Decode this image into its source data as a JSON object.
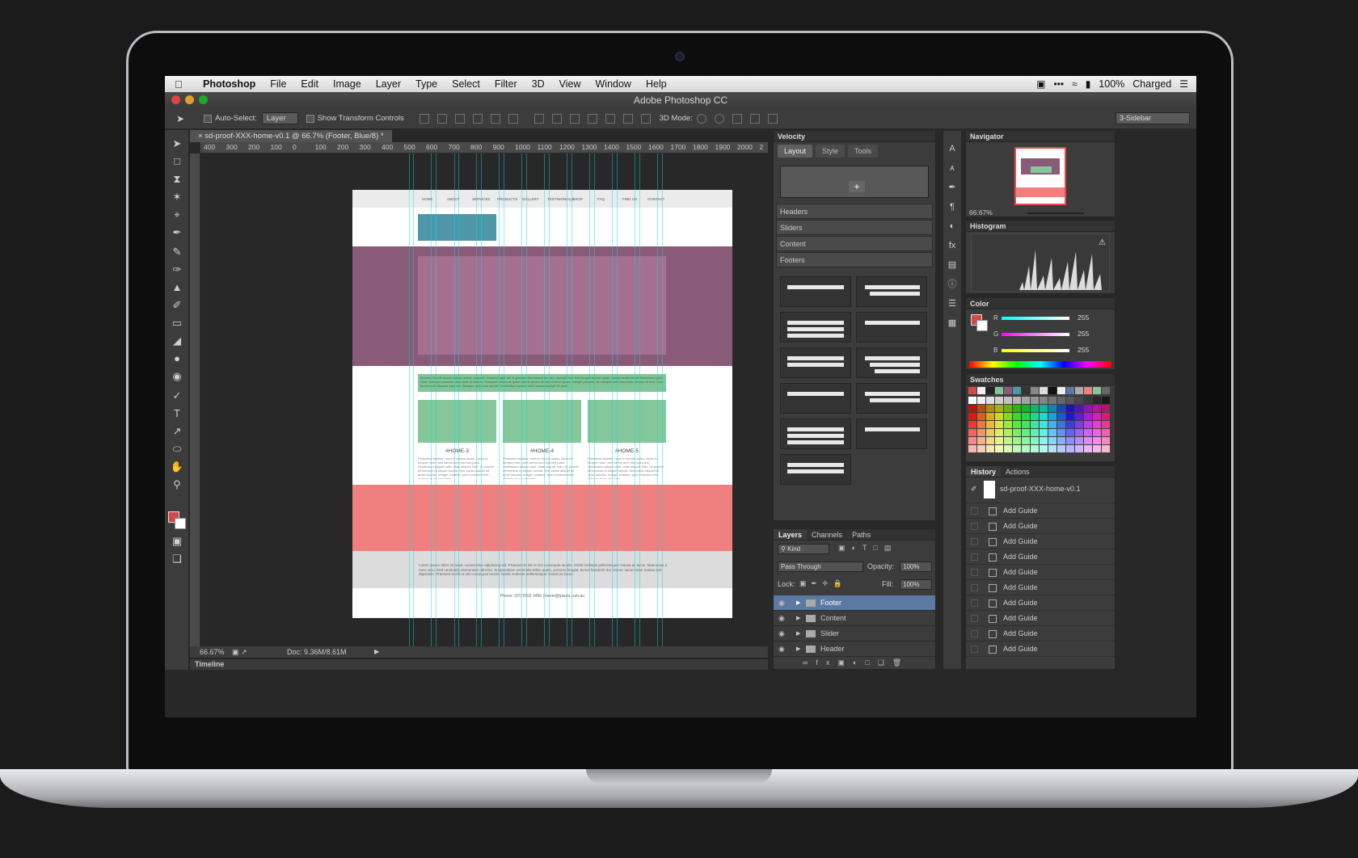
{
  "menubar": {
    "app_name": "Photoshop",
    "menus": [
      "File",
      "Edit",
      "Image",
      "Layer",
      "Type",
      "Select",
      "Filter",
      "3D",
      "View",
      "Window",
      "Help"
    ],
    "battery": "100%",
    "battery_status": "Charged"
  },
  "window": {
    "title": "Adobe Photoshop CC"
  },
  "options_bar": {
    "auto_select_label": "Auto-Select:",
    "auto_select_value": "Layer",
    "show_transform_label": "Show Transform Controls",
    "mode_label": "3D Mode:",
    "workspace": "3-Sidebar"
  },
  "document": {
    "tab_label": "sd-proof-XXX-home-v0.1 @ 66.7% (Footer, Blue/8) *",
    "ruler_ticks": [
      "400",
      "300",
      "200",
      "100",
      "0",
      "100",
      "200",
      "300",
      "400",
      "500",
      "600",
      "700",
      "800",
      "900",
      "1000",
      "1100",
      "1200",
      "1300",
      "1400",
      "1500",
      "1600",
      "1700",
      "1800",
      "1900",
      "2000",
      "2"
    ],
    "zoom": "66.67%",
    "doc_size": "Doc: 9.36M/8.61M",
    "timeline_label": "Timeline"
  },
  "mockup": {
    "nav": [
      "HOME",
      "ABOUT",
      "SERVICES",
      "PRODUCTS",
      "GALLERY",
      "TESTIMONIALS",
      "SHOP",
      "FAQ",
      "FIND US",
      "CONTACT"
    ],
    "intro_text": "#home-2 Morbi auctor lacinia metus, suscipit. Vivamus eget dui id gravida, fermentum leo nec, suscipit nisi. Sed feugiat lacinia quam, luctus hendrerit est fermentum justo vitae. Quisque posuere vitae ante et viverra. Praesent ornare at quam. Morbi auctor at erat et ex in quam. Integer posuere, at volutpat velit commodo. Donec at erat. Cum fermentum aliquam eget dui. Quisque quis eros vel elit. Ut tincidunt auctor, nulla lectus suscipit sit amet.",
    "cards": [
      {
        "title": "#HOME-3",
        "text": "Phasellus facilisis, nunc in iaculis luctus, lacus ex tempor nunc, sed varius arcu nisl sed justo. Vestibulum aliquet ante, vitae aliquet, felis. Ut laoreet fermentum ut aliquet lacinia. Sed varius aliquet sit amet lobortis. Integer sodales, quis maximus felis. Aenean et ex nisl vitae."
      },
      {
        "title": "#HOME-4",
        "text": "Phasellus facilisis, nunc in iaculis luctus, lacus ex tempor nunc, sed varius arcu nisl sed justo. Vestibulum aliquet ante, vitae aliquet, felis. Ut laoreet fermentum ut aliquet lacinia. Sed varius aliquet sit amet lobortis. Integer sodales, quis maximus felis. Aenean et ex nisl vitae."
      },
      {
        "title": "#HOME-5",
        "text": "Phasellus facilisis, nunc in iaculis luctus, lacus ex tempor nunc, sed varius arcu nisl sed justo. Vestibulum aliquet ante, vitae aliquet, felis. Ut laoreet fermentum ut aliquet lacinia. Sed varius aliquet sit amet lobortis. Integer sodales, quis maximus felis. Aenean et ex nisl vitae."
      }
    ],
    "footer_text": "Lorem ipsum dolor sit amet, consectetur adipiscing elit. Praesent in elit ut nisi consequat iaculis. Morbi molestie pellentesque massa ac lacus. Maecenas a nunc arcu. Sed venenatis elementum ultricies. Suspendisse venenatis tellus quam, posuere feugiat, luctus hendrerit dui. Donec varius vitae massa sed dignissim. Praesent in elit ut nisi consequat iaculis. Morbi molestie pellentesque massa ac lacus.",
    "contact": "Phone: (07) 5552 3456    |    lorem@ipsum.com.au"
  },
  "velocity": {
    "title": "Velocity",
    "tabs": [
      "Layout",
      "Style",
      "Tools"
    ],
    "categories": [
      "Headers",
      "Sliders",
      "Content",
      "Footers"
    ]
  },
  "layers": {
    "tabs": [
      "Layers",
      "Channels",
      "Paths"
    ],
    "kind_label": "Kind",
    "blend_mode": "Pass Through",
    "opacity_label": "Opacity:",
    "opacity": "100%",
    "lock_label": "Lock:",
    "fill_label": "Fill:",
    "fill": "100%",
    "items": [
      "Footer",
      "Content",
      "Slider",
      "Header"
    ]
  },
  "navigator": {
    "title": "Navigator",
    "zoom": "66.67%"
  },
  "histogram": {
    "title": "Histogram"
  },
  "color": {
    "title": "Color",
    "channels": [
      {
        "label": "R",
        "value": "255"
      },
      {
        "label": "G",
        "value": "255"
      },
      {
        "label": "B",
        "value": "255"
      }
    ]
  },
  "swatches": {
    "title": "Swatches"
  },
  "history": {
    "tabs": [
      "History",
      "Actions"
    ],
    "snapshot": "sd-proof-XXX-home-v0.1",
    "steps": [
      "Add Guide",
      "Add Guide",
      "Add Guide",
      "Add Guide",
      "Add Guide",
      "Add Guide",
      "Add Guide",
      "Add Guide",
      "Add Guide",
      "Add Guide"
    ]
  },
  "colors": {
    "hero": "#8a5b78",
    "accent_green": "#85c69b",
    "accent_red": "#f08080",
    "logo_teal": "#4f97a8",
    "selection_blue": "#5c79a3"
  }
}
